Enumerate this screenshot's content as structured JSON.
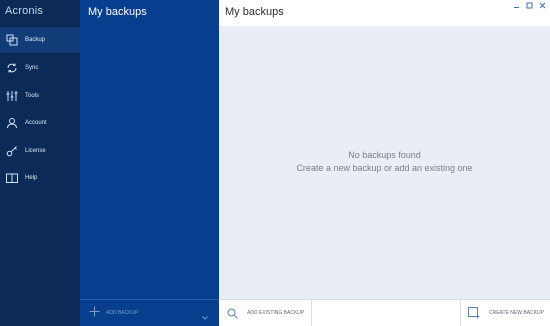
{
  "app": {
    "brand": "Acronis"
  },
  "nav": {
    "items": [
      {
        "label": "Backup",
        "icon": "backup-icon",
        "active": true
      },
      {
        "label": "Sync",
        "icon": "sync-icon",
        "active": false
      },
      {
        "label": "Tools",
        "icon": "tools-icon",
        "active": false
      },
      {
        "label": "Account",
        "icon": "account-icon",
        "active": false
      },
      {
        "label": "License",
        "icon": "license-key-icon",
        "active": false
      },
      {
        "label": "Help",
        "icon": "help-book-icon",
        "active": false
      }
    ]
  },
  "list": {
    "title": "My backups",
    "add_label": "ADD BACKUP"
  },
  "main": {
    "title": "My backups",
    "empty_title": "No backups found",
    "empty_subtitle": "Create a new backup or add an existing one",
    "add_existing_label": "ADD EXISTING BACKUP",
    "create_new_label": "CREATE NEW BACKUP"
  },
  "colors": {
    "nav_bg": "#0b2a57",
    "list_bg": "#073e8e",
    "main_bg": "#e9edf5"
  }
}
